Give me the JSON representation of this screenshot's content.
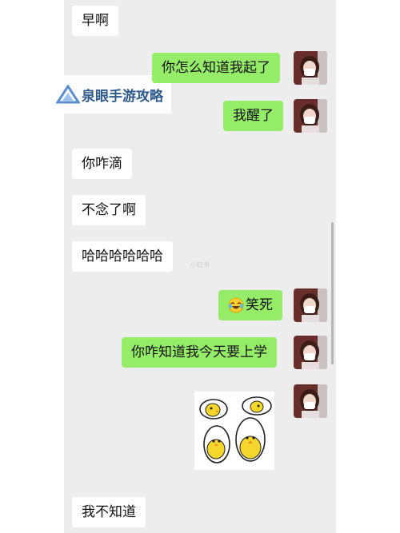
{
  "watermark": {
    "brand": "泉眼手游攻略",
    "small_logo": "小红书"
  },
  "messages": [
    {
      "side": "in",
      "text": "早啊"
    },
    {
      "side": "out",
      "text": "你怎么知道我起了"
    },
    {
      "side": "out",
      "text": "我醒了"
    },
    {
      "side": "in",
      "text": "你咋滴"
    },
    {
      "side": "in",
      "text": "不念了啊"
    },
    {
      "side": "in",
      "text": "哈哈哈哈哈哈"
    },
    {
      "side": "out",
      "text": "笑死",
      "emoji": "laughing-crying-emoji"
    },
    {
      "side": "out",
      "text": "你咋知道我今天要上学"
    },
    {
      "side": "out",
      "type": "sticker",
      "sticker": "chicks-sticker"
    },
    {
      "side": "in",
      "text": "我不知道"
    }
  ],
  "colors": {
    "chat_bg": "#ededed",
    "bubble_in": "#ffffff",
    "bubble_out": "#95ec69",
    "watermark_text": "#2e5a8c"
  }
}
